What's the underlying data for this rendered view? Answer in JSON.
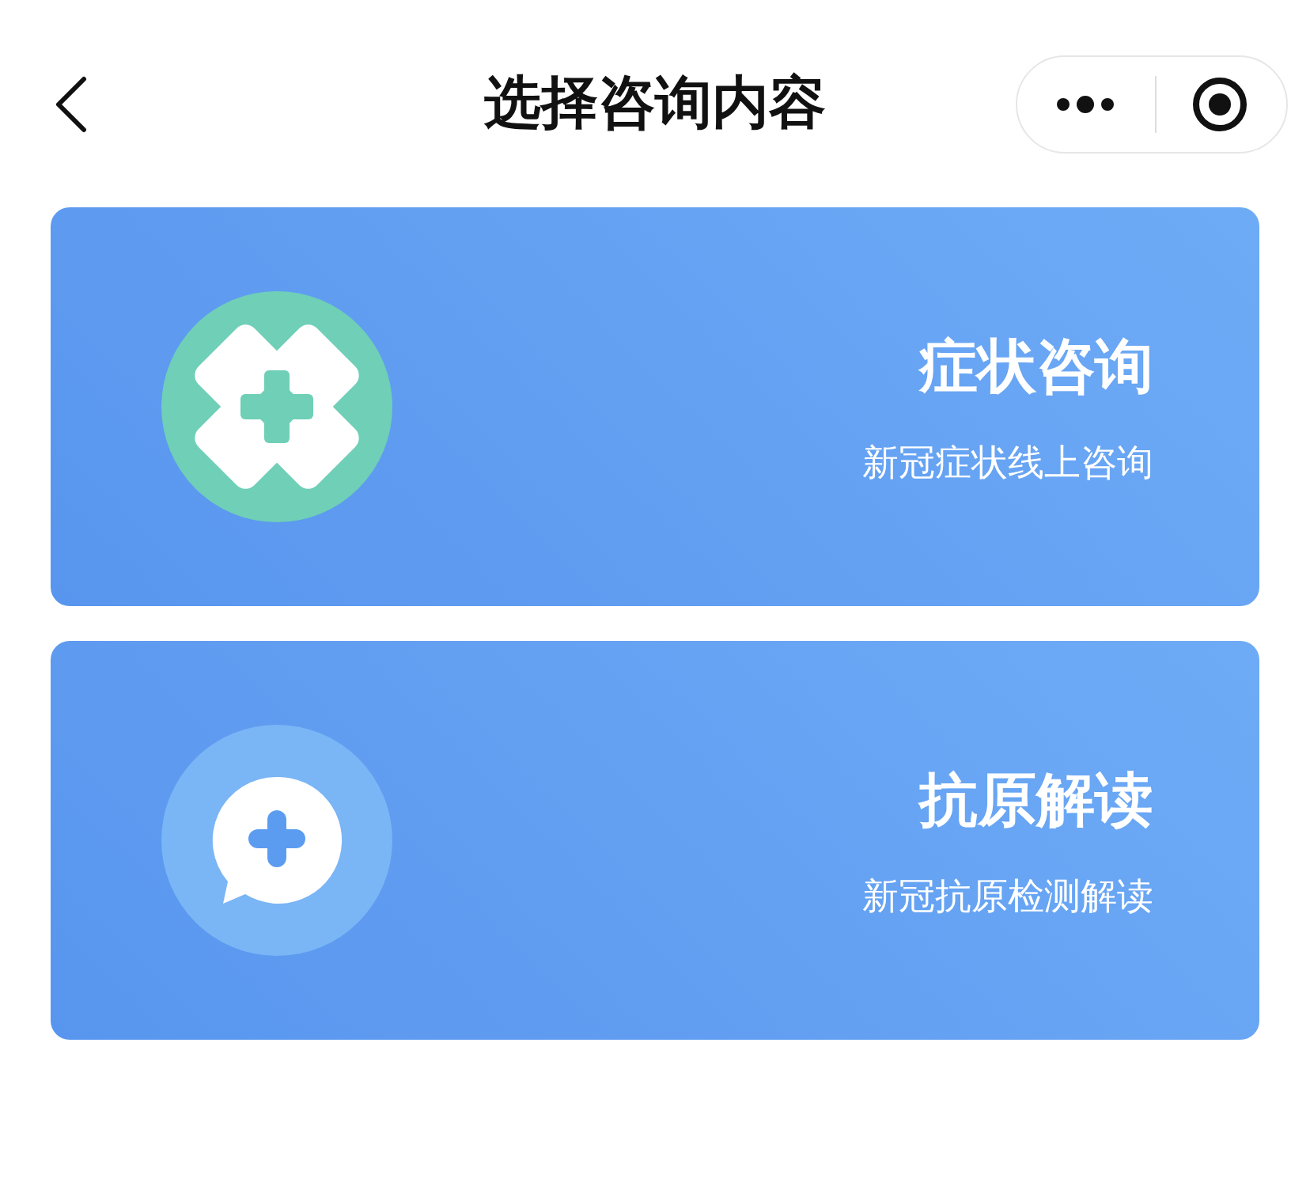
{
  "header": {
    "title": "选择咨询内容"
  },
  "cards": [
    {
      "kind": "clover",
      "title": "症状咨询",
      "subtitle": "新冠症状线上咨询"
    },
    {
      "kind": "chat",
      "title": "抗原解读",
      "subtitle": "新冠抗原检测解读"
    }
  ]
}
